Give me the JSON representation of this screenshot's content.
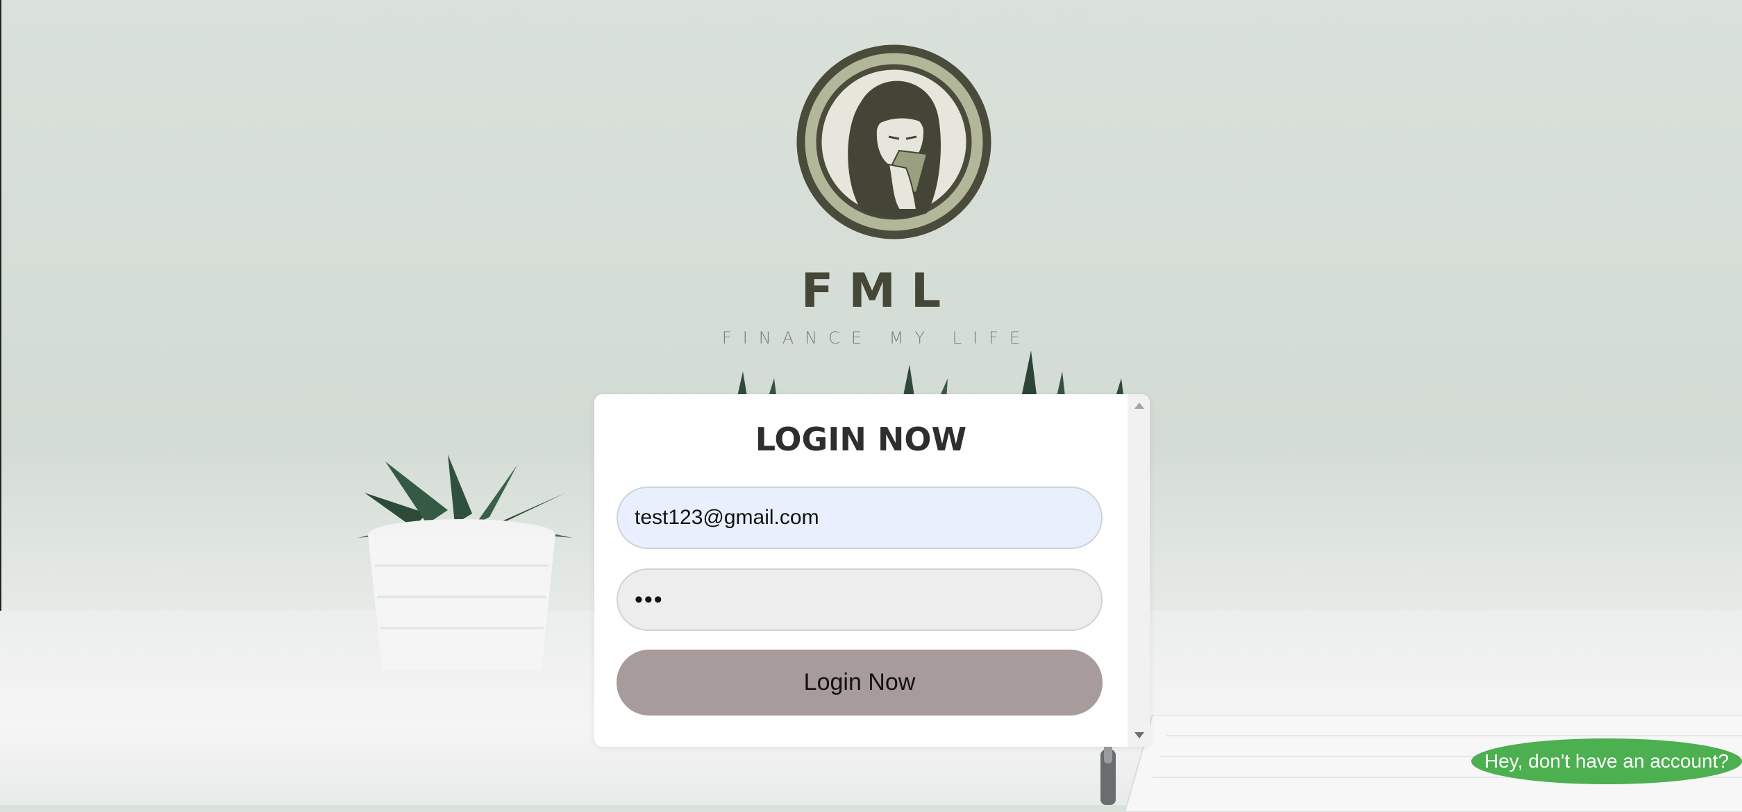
{
  "brand": {
    "title": "FML",
    "subtitle": "FINANCE MY LIFE"
  },
  "login": {
    "heading": "LOGIN NOW",
    "email_value": "test123@gmail.com",
    "password_value": "•••",
    "submit_label": "Login Now"
  },
  "signup_prompt": "Hey, don't have an account?",
  "colors": {
    "button": "#a89b9b",
    "email_field_bg": "#e8f0fe",
    "password_field_bg": "#ededed",
    "signup_pill": "#4caf50",
    "brand_dark": "#454837"
  },
  "icons": {
    "logo": "woman-holding-cash-logo"
  }
}
